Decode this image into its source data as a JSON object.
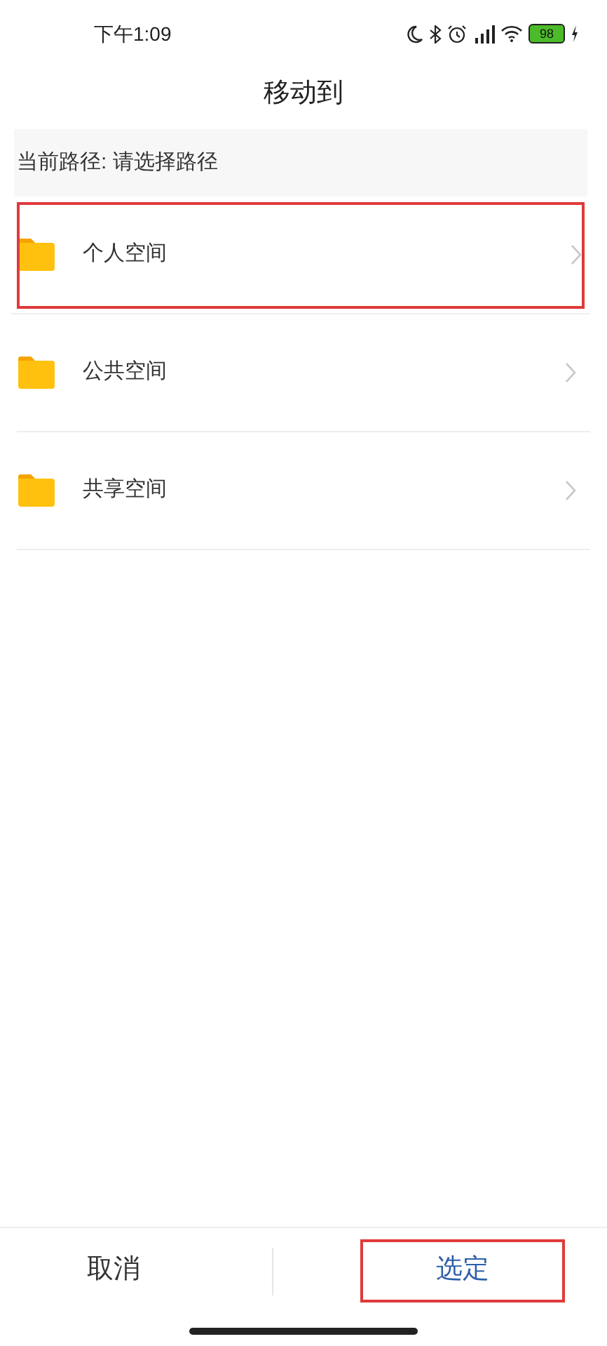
{
  "status_bar": {
    "time": "下午1:09",
    "battery": "98"
  },
  "title": "移动到",
  "path_bar": {
    "text": "当前路径: 请选择路径"
  },
  "folders": [
    {
      "label": "个人空间",
      "highlighted": true
    },
    {
      "label": "公共空间",
      "highlighted": false
    },
    {
      "label": "共享空间",
      "highlighted": false
    }
  ],
  "buttons": [
    {
      "label": "取消",
      "kind": "cancel",
      "highlighted": false
    },
    {
      "label": "选定",
      "kind": "confirm",
      "highlighted": true
    }
  ]
}
